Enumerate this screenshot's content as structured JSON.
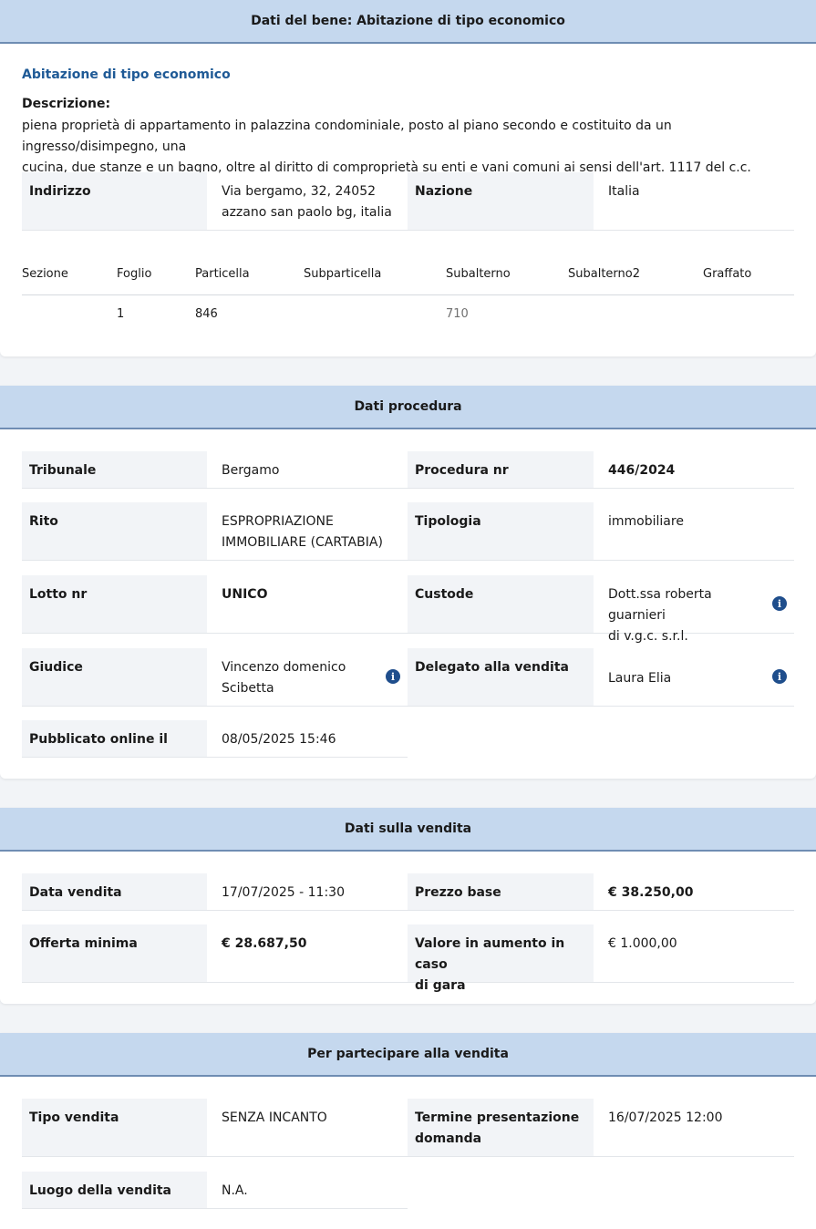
{
  "bene": {
    "header": "Dati del bene: Abitazione di tipo economico",
    "title": "Abitazione di tipo economico",
    "descr_label": "Descrizione:",
    "descr_line1": "piena proprietà di appartamento in palazzina condominiale, posto al piano secondo e costituito da un ingresso/disimpegno, una",
    "descr_line2": "cucina, due stanze e un bagno, oltre al diritto di comproprietà su enti e vani comuni ai sensi dell'art. 1117 del c.c.",
    "indirizzo_label": "Indirizzo",
    "indirizzo_line1": "Via bergamo, 32, 24052",
    "indirizzo_line2": "azzano san paolo bg, italia",
    "nazione_label": "Nazione",
    "nazione_value": "Italia",
    "catasto": {
      "headers": [
        "Sezione",
        "Foglio",
        "Particella",
        "Subparticella",
        "Subalterno",
        "Subalterno2",
        "Graffato"
      ],
      "row": [
        "",
        "1",
        "846",
        "",
        "710",
        "",
        ""
      ]
    }
  },
  "procedura": {
    "header": "Dati procedura",
    "tribunale_label": "Tribunale",
    "tribunale_value": "Bergamo",
    "procedura_label": "Procedura nr",
    "procedura_value": "446/2024",
    "rito_label": "Rito",
    "rito_line1": "ESPROPRIAZIONE",
    "rito_line2": "IMMOBILIARE (CARTABIA)",
    "tipologia_label": "Tipologia",
    "tipologia_value": "immobiliare",
    "lotto_label": "Lotto nr",
    "lotto_value": "UNICO",
    "custode_label": "Custode",
    "custode_line1": "Dott.ssa roberta guarnieri",
    "custode_line2": "di v.g.c. s.r.l.",
    "giudice_label": "Giudice",
    "giudice_line1": "Vincenzo domenico",
    "giudice_line2": "Scibetta",
    "delegato_label": "Delegato alla vendita",
    "delegato_value": "Laura Elia",
    "pubblicato_label": "Pubblicato online il",
    "pubblicato_value": "08/05/2025 15:46"
  },
  "vendita": {
    "header": "Dati sulla vendita",
    "data_label": "Data vendita",
    "data_value": "17/07/2025 - 11:30",
    "prezzo_label": "Prezzo base",
    "prezzo_value": "€ 38.250,00",
    "offerta_label": "Offerta minima",
    "offerta_value": "€ 28.687,50",
    "aumento_line1": "Valore in aumento in caso",
    "aumento_line2": "di gara",
    "aumento_value": "€ 1.000,00"
  },
  "partecipare": {
    "header": "Per partecipare alla vendita",
    "tipo_label": "Tipo vendita",
    "tipo_value": "SENZA INCANTO",
    "termine_line1": "Termine presentazione",
    "termine_line2": "domanda",
    "termine_value": "16/07/2025 12:00",
    "luogo_label": "Luogo della vendita",
    "luogo_value": "N.A."
  },
  "icons": {
    "info": "info-icon",
    "info_glyph": "i"
  },
  "colors": {
    "header_bg": "#c5d8ee",
    "header_border": "#6f8db3",
    "title_blue": "#1f5a96",
    "icon_blue": "#1f4e8c",
    "label_bg": "#f2f4f7"
  }
}
